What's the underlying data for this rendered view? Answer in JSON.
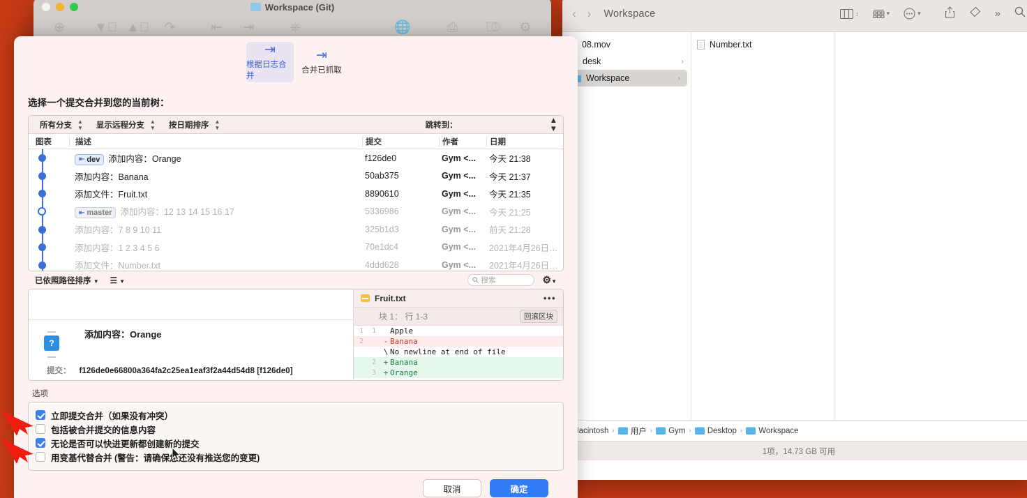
{
  "finder": {
    "title": "Workspace",
    "nav": {
      "back": "‹",
      "forward": "›"
    },
    "toolbar_icons": [
      "column-view-icon",
      "group-by-icon",
      "action-menu-icon",
      "share-icon",
      "tag-icon",
      "more-toolbar-icon",
      "search-icon"
    ],
    "columns": [
      {
        "items": [
          {
            "label": "08.mov",
            "icon": "movie-file-icon",
            "selected": false,
            "disclosure": false
          },
          {
            "label": "desk",
            "icon": "folder-icon",
            "selected": false,
            "disclosure": true
          },
          {
            "label": "Workspace",
            "icon": "folder-icon",
            "selected": true,
            "disclosure": true
          }
        ]
      },
      {
        "items": [
          {
            "label": "Number.txt",
            "icon": "text-file-icon",
            "selected": false,
            "disclosure": false
          }
        ]
      },
      {
        "items": []
      }
    ],
    "path_bar": [
      "Macintosh",
      "用户",
      "Gym",
      "Desktop",
      "Workspace"
    ],
    "status": "1项，14.73 GB 可用"
  },
  "git_window": {
    "title": "Workspace (Git)",
    "toolbar": [
      {
        "label": "提交",
        "icon": "commit-plus-icon",
        "glyph": "⊕"
      },
      {
        "label": "拉取",
        "icon": "pull-down-icon",
        "glyph": "↓"
      },
      {
        "label": "推送",
        "icon": "push-up-icon",
        "glyph": "↑"
      },
      {
        "label": "抓取",
        "icon": "fetch-icon",
        "glyph": "↧"
      },
      {
        "label": "分支",
        "icon": "branch-icon",
        "glyph": "⎇"
      },
      {
        "label": "合并",
        "icon": "merge-icon",
        "glyph": "⑂"
      },
      {
        "label": "贮藏",
        "icon": "stash-icon",
        "glyph": "⛁"
      },
      {
        "label": "显示远程服务器",
        "icon": "globe-icon",
        "glyph": "ἱ0"
      },
      {
        "label": "在 Finder 中显示",
        "icon": "finder-reveal-icon",
        "glyph": "⬚"
      },
      {
        "label": "终端",
        "icon": "terminal-icon",
        "glyph": "⬚"
      },
      {
        "label": "设置",
        "icon": "gear-icon",
        "glyph": "⚙"
      }
    ]
  },
  "sheet": {
    "tabs": [
      {
        "label": "根据日志合并",
        "icon": "merge-log-icon",
        "active": true
      },
      {
        "label": "合并已抓取",
        "icon": "merge-fetched-icon",
        "active": false
      }
    ],
    "prompt": "选择一个提交合并到您的当前树：",
    "filters": [
      {
        "label": "所有分支"
      },
      {
        "label": "显示远程分支"
      },
      {
        "label": "按日期排序"
      }
    ],
    "jump_to_label": "跳转到：",
    "table_headers": {
      "graph": "图表",
      "description": "描述",
      "commit": "提交",
      "author": "作者",
      "date": "日期"
    },
    "commits": [
      {
        "branch": "dev",
        "branch_dim": false,
        "description": "添加内容：Orange",
        "hash": "f126de0",
        "author": "Gym <...",
        "date": "今天 21:38",
        "dim": false,
        "head": false
      },
      {
        "branch": null,
        "branch_dim": false,
        "description": "添加内容：Banana",
        "hash": "50ab375",
        "author": "Gym <...",
        "date": "今天 21:37",
        "dim": false,
        "head": false
      },
      {
        "branch": null,
        "branch_dim": false,
        "description": "添加文件：Fruit.txt",
        "hash": "8890610",
        "author": "Gym <...",
        "date": "今天 21:35",
        "dim": false,
        "head": false
      },
      {
        "branch": "master",
        "branch_dim": true,
        "description": "添加内容：12 13 14 15 16 17",
        "hash": "5336986",
        "author": "Gym <...",
        "date": "今天 21:25",
        "dim": true,
        "head": true
      },
      {
        "branch": null,
        "branch_dim": false,
        "description": "添加内容：7 8 9 10 11",
        "hash": "325b1d3",
        "author": "Gym <...",
        "date": "前天 21:28",
        "dim": true,
        "head": false
      },
      {
        "branch": null,
        "branch_dim": false,
        "description": "添加内容：1 2 3 4 5 6",
        "hash": "70e1dc4",
        "author": "Gym <...",
        "date": "2021年4月26日…",
        "dim": true,
        "head": false
      },
      {
        "branch": null,
        "branch_dim": false,
        "description": "添加文件：Number.txt",
        "hash": "4ddd628",
        "author": "Gym <...",
        "date": "2021年4月26日…",
        "dim": true,
        "head": false
      }
    ],
    "sort_label": "已依照路径排序",
    "view_icon_label": "☰",
    "search_placeholder": "搜索",
    "detail": {
      "message": "添加内容：Orange",
      "commit_label": "提交：",
      "commit_hash": "f126de0e66800a364fa2c25ea1eaf3f2a44d54d8 [f126de0]",
      "avatar_glyph": "?"
    },
    "diff": {
      "filename": "Fruit.txt",
      "hunk_header": "块 1： 行 1-3",
      "revert_label": "回滚区块",
      "lines": [
        {
          "old": "1",
          "new": "1",
          "sign": "",
          "text": "Apple",
          "type": "ctx"
        },
        {
          "old": "2",
          "new": "",
          "sign": "-",
          "text": "Banana",
          "type": "del"
        },
        {
          "old": "",
          "new": "",
          "sign": "\\",
          "text": "No newline at end of file",
          "type": "meta"
        },
        {
          "old": "",
          "new": "2",
          "sign": "+",
          "text": "Banana",
          "type": "add"
        },
        {
          "old": "",
          "new": "3",
          "sign": "+",
          "text": "Orange",
          "type": "add"
        }
      ]
    },
    "options_label": "选项",
    "options": [
      {
        "label": "立即提交合并（如果没有冲突）",
        "checked": true,
        "annotated": true
      },
      {
        "label": "包括被合并提交的信息内容",
        "checked": false,
        "annotated": false
      },
      {
        "label": "无论是否可以快进更新都创建新的提交",
        "checked": true,
        "annotated": true
      },
      {
        "label": "用变基代替合并 (警告：请确保您还没有推送您的变更)",
        "checked": false,
        "annotated": false
      }
    ],
    "buttons": {
      "cancel": "取消",
      "confirm": "确定"
    }
  },
  "colors": {
    "desktop": "#c73a16",
    "accent_blue": "#3b7ff0",
    "graph_blue": "#3b6fd4",
    "annotation_red": "#ee1d10",
    "diff_add": "#e6f7ec",
    "diff_del": "#fdecea"
  }
}
